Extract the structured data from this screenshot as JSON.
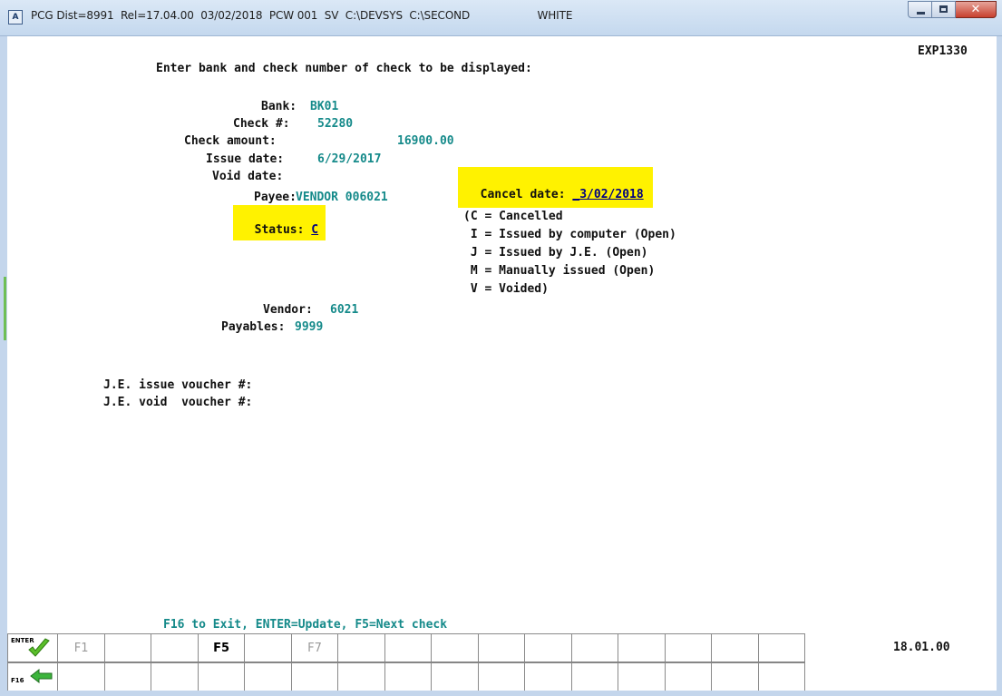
{
  "window": {
    "icon_letter": "A",
    "title": "PCG Dist=8991  Rel=17.04.00  03/02/2018  PCW 001  SV  C:\\DEVSYS  C:\\SECOND                    WHITE",
    "minimize_icon": "minimize-icon",
    "maximize_icon": "maximize-icon",
    "close_icon": "close-icon"
  },
  "screen": {
    "program_id": "EXP1330",
    "prompt": "Enter bank and check number of check to be displayed:",
    "fields": {
      "bank_label": "Bank:",
      "bank_value": "BK01",
      "check_label": "Check #:",
      "check_value": "52280",
      "amount_label": "Check amount:",
      "amount_value": "16900.00",
      "issue_date_label": "Issue date:",
      "issue_date_value": "6/29/2017",
      "void_date_label": "Void date:",
      "void_date_value": "",
      "cancel_date_label": "Cancel date:",
      "cancel_date_value": "_3/02/2018",
      "payee_label": "Payee:",
      "payee_value": "VENDOR 006021",
      "status_label": "Status:",
      "status_value": "C",
      "vendor_label": "Vendor:",
      "vendor_value": "6021",
      "payables_label": "Payables:",
      "payables_value": "9999",
      "je_issue_label": "J.E. issue voucher #:",
      "je_void_label": "J.E. void  voucher #:"
    },
    "status_legend": [
      "(C = Cancelled",
      " I = Issued by computer (Open)",
      " J = Issued by J.E. (Open)",
      " M = Manually issued (Open)",
      " V = Voided)"
    ],
    "hint": "F16 to Exit, ENTER=Update, F5=Next check",
    "time": "18.01.00"
  },
  "fkeys": {
    "enter_label": "ENTER",
    "f16_label": "F16",
    "row1": [
      "F1",
      "",
      "",
      "F5",
      "",
      "F7",
      "",
      "",
      "",
      "",
      "",
      "",
      "",
      "",
      "",
      ""
    ],
    "row2": [
      "",
      "",
      "",
      "",
      "",
      "",
      "",
      "",
      "",
      "",
      "",
      "",
      "",
      "",
      "",
      ""
    ]
  },
  "colors": {
    "value_teal": "#158a8a",
    "highlight_yellow": "#fff200",
    "enter_check_green": "#5bbf2a",
    "exit_arrow_green": "#3cb43c"
  }
}
